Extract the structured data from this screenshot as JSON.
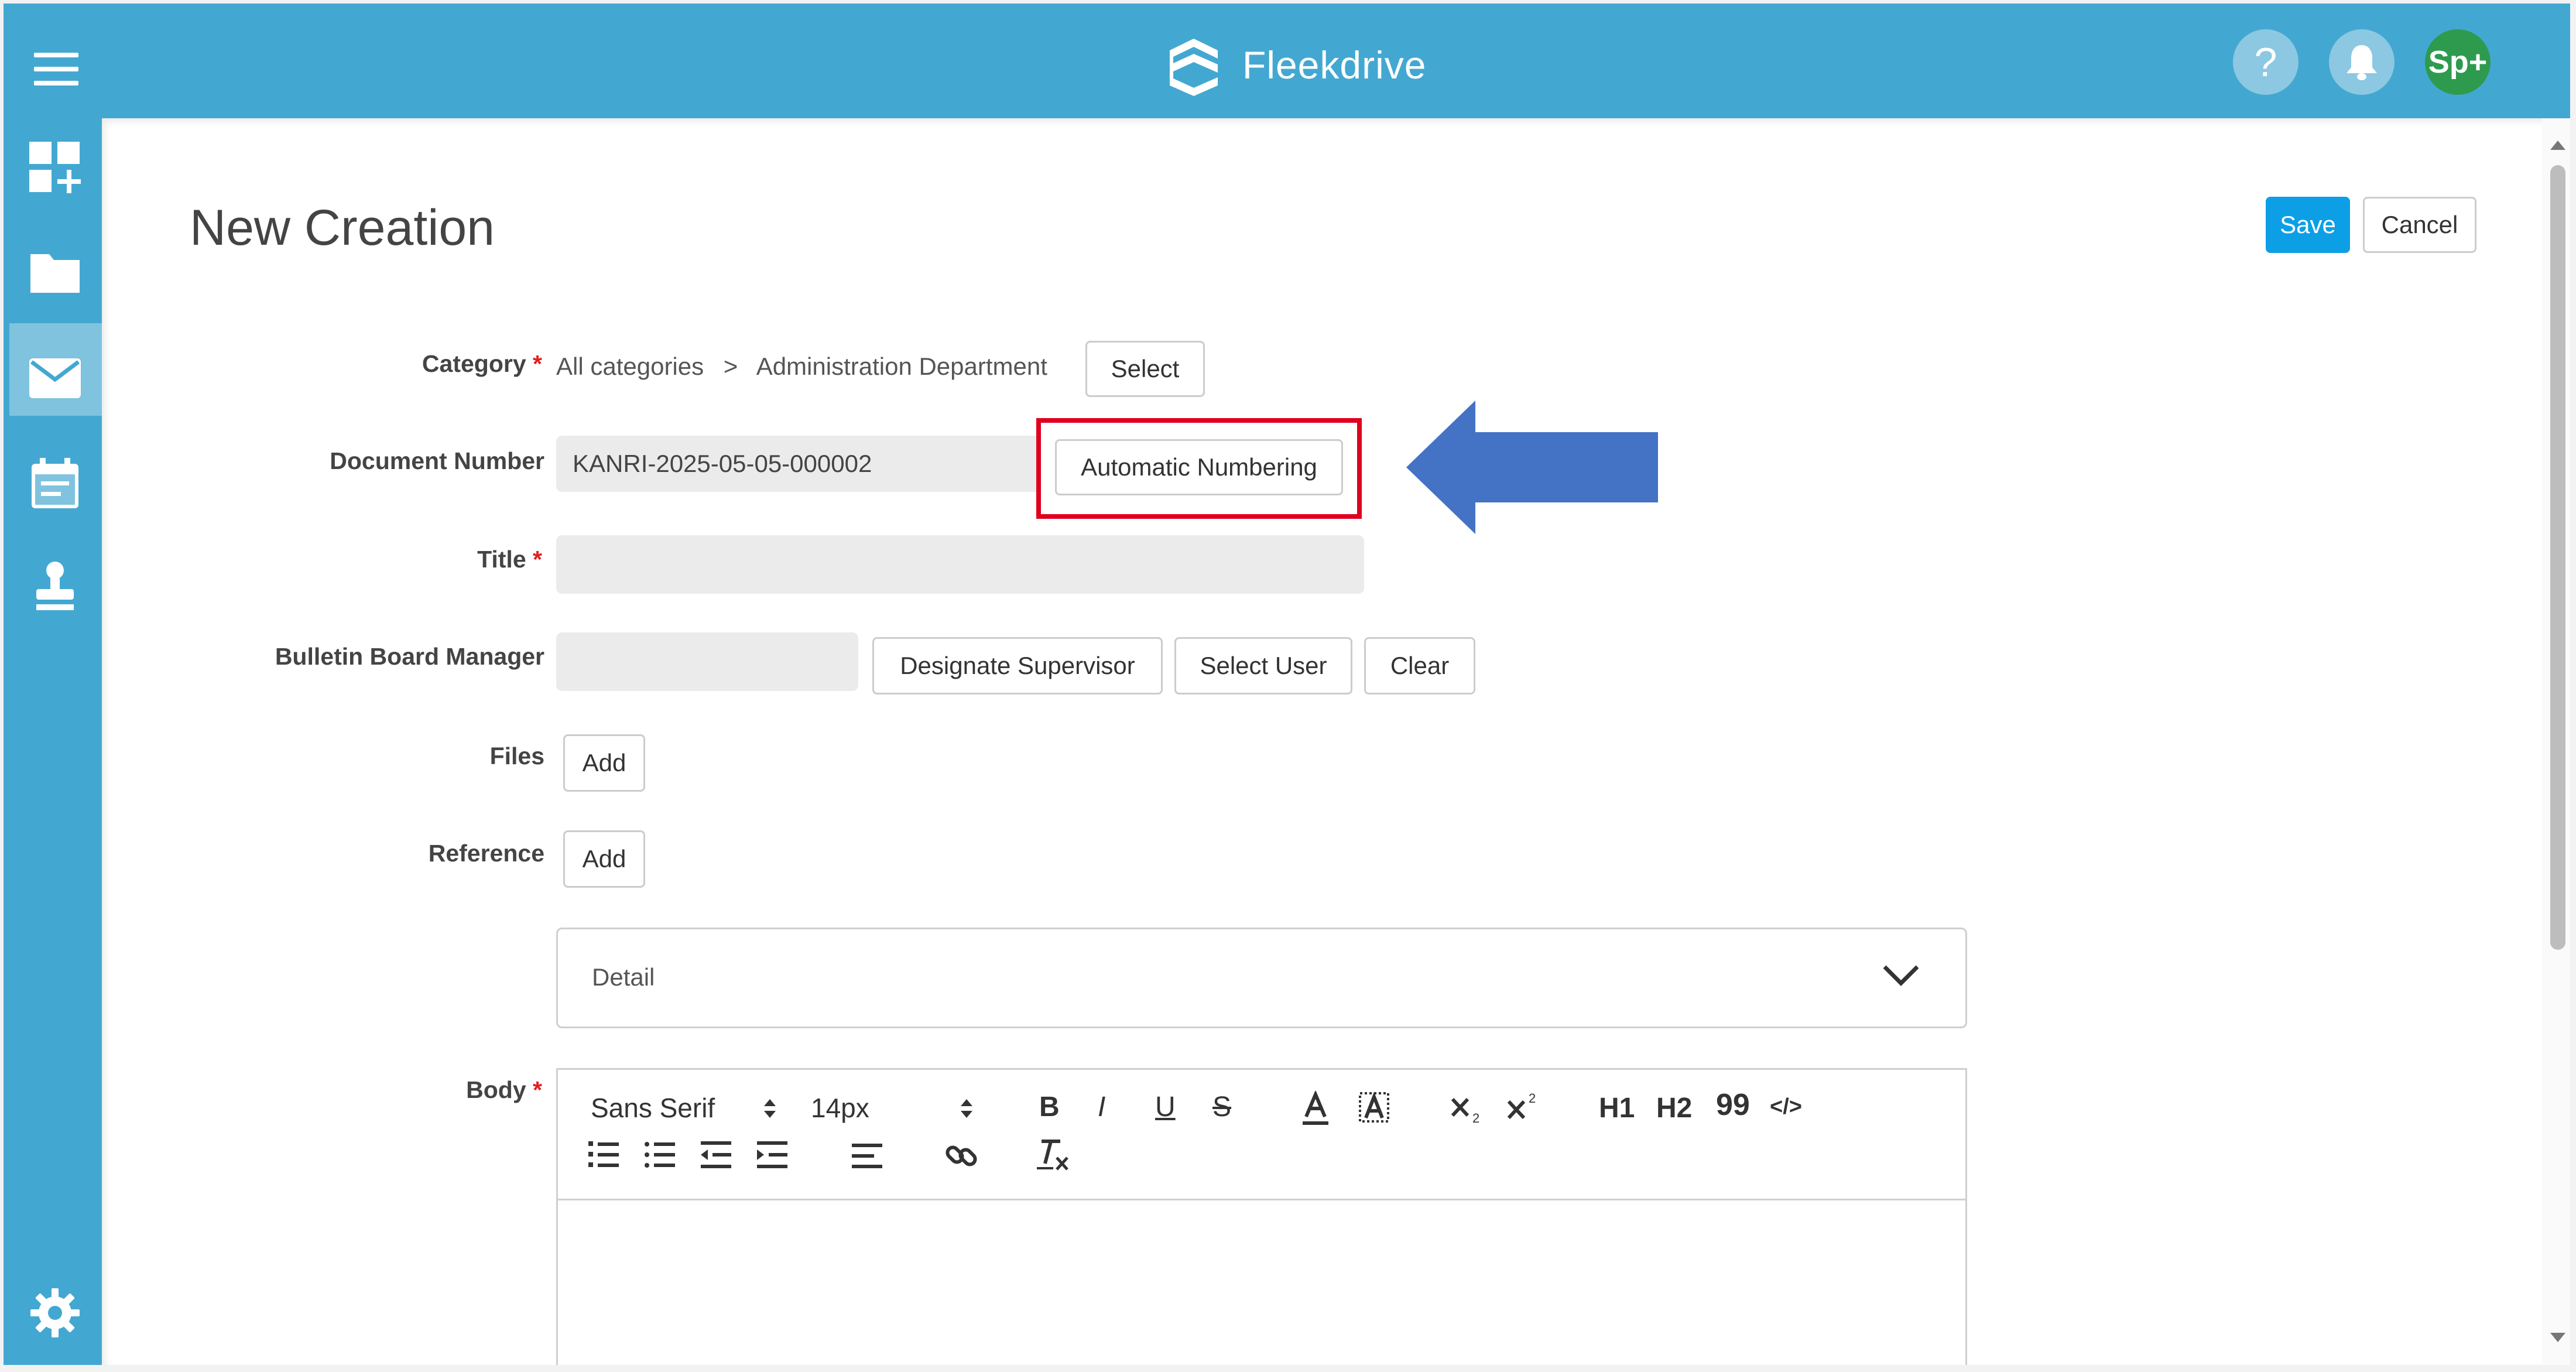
{
  "header": {
    "app_name": "Fleekdrive",
    "help_icon": "?",
    "avatar_text": "Sp+"
  },
  "sidebar": {
    "icons": [
      "dashboard-add-icon",
      "folder-icon",
      "mail-icon",
      "calendar-icon",
      "stamp-icon",
      "gear-icon"
    ]
  },
  "page": {
    "title": "New Creation",
    "save_label": "Save",
    "cancel_label": "Cancel"
  },
  "form": {
    "category": {
      "label": "Category",
      "path_root": "All categories",
      "separator": ">",
      "path_leaf": "Administration Department",
      "select_label": "Select"
    },
    "document_number": {
      "label": "Document Number",
      "value": "KANRI-2025-05-05-000002",
      "auto_label": "Automatic Numbering"
    },
    "title": {
      "label": "Title",
      "value": ""
    },
    "manager": {
      "label": "Bulletin Board Manager",
      "value": "",
      "designate_label": "Designate Supervisor",
      "select_user_label": "Select User",
      "clear_label": "Clear"
    },
    "files": {
      "label": "Files",
      "add_label": "Add"
    },
    "reference": {
      "label": "Reference",
      "add_label": "Add"
    },
    "detail": {
      "label": "Detail"
    },
    "body": {
      "label": "Body",
      "font_family": "Sans Serif",
      "font_size": "14px",
      "toolbar": {
        "bold": "B",
        "italic": "I",
        "underline": "U",
        "strike": "S",
        "h1": "H1",
        "h2": "H2",
        "quote": "99",
        "code": "</>",
        "clear_format": "Tx"
      }
    }
  },
  "required_mark": "*",
  "colors": {
    "header": "#43a8d1",
    "primary_button": "#0d9fe6",
    "highlight_box": "#e0001e",
    "arrow": "#4472c4",
    "avatar": "#2e9a4e"
  }
}
